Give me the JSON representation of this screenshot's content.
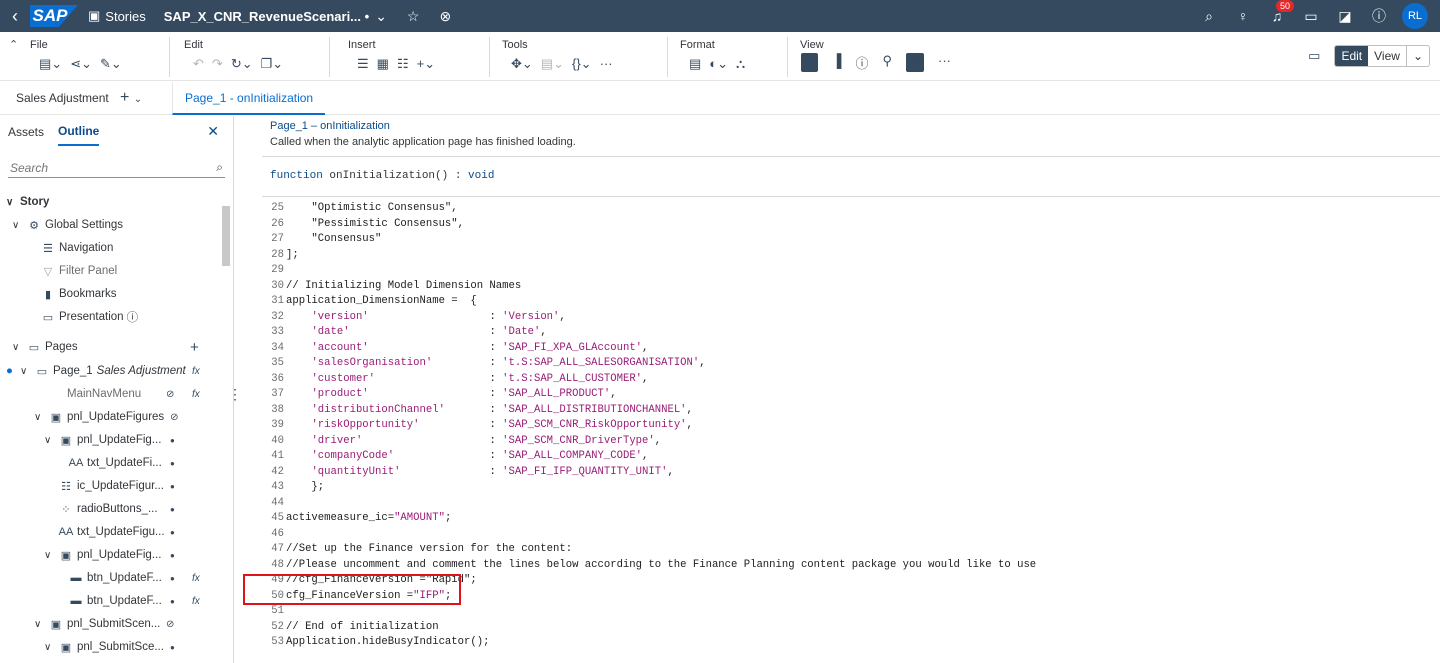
{
  "shell": {
    "logo": "SAP",
    "stories_label": "Stories",
    "story_title": "SAP_X_CNR_RevenueScenari... •",
    "notification_count": "50",
    "avatar_initials": "RL"
  },
  "toolbar": {
    "file_label": "File",
    "edit_label": "Edit",
    "insert_label": "Insert",
    "tools_label": "Tools",
    "format_label": "Format",
    "view_label": "View",
    "mode_edit": "Edit",
    "mode_view": "View"
  },
  "tabbar": {
    "sales_adjustment": "Sales Adjustment",
    "page_tab": "Page_1 - onInitialization"
  },
  "left_panel": {
    "tab_assets": "Assets",
    "tab_outline": "Outline",
    "search_placeholder": "Search",
    "tree": [
      {
        "label": "Story"
      },
      {
        "label": "Global Settings"
      },
      {
        "label": "Navigation"
      },
      {
        "label": "Filter Panel"
      },
      {
        "label": "Bookmarks"
      },
      {
        "label": "Presentation"
      },
      {
        "label": "Pages"
      },
      {
        "label": "Page_1",
        "suffix": "Sales Adjustment"
      },
      {
        "label": "MainNavMenu"
      },
      {
        "label": "pnl_UpdateFigures"
      },
      {
        "label": "pnl_UpdateFig..."
      },
      {
        "label": "txt_UpdateFi..."
      },
      {
        "label": "ic_UpdateFigur..."
      },
      {
        "label": "radioButtons_..."
      },
      {
        "label": "txt_UpdateFigu..."
      },
      {
        "label": "pnl_UpdateFig..."
      },
      {
        "label": "btn_UpdateF..."
      },
      {
        "label": "btn_UpdateF..."
      },
      {
        "label": "pnl_SubmitScen..."
      },
      {
        "label": "pnl_SubmitSce..."
      }
    ]
  },
  "editor": {
    "header_title": "Page_1 – onInitialization",
    "header_desc": "Called when the analytic application page has finished loading.",
    "sig_kw": "function",
    "sig_name": " onInitialization() : ",
    "sig_type": "void",
    "lines": [
      {
        "n": "25",
        "t": "    \"Optimistic Consensus\","
      },
      {
        "n": "26",
        "t": "    \"Pessimistic Consensus\","
      },
      {
        "n": "27",
        "t": "    \"Consensus\""
      },
      {
        "n": "28",
        "t": "];"
      },
      {
        "n": "29",
        "t": ""
      },
      {
        "n": "30",
        "t": "// Initializing Model Dimension Names"
      },
      {
        "n": "31",
        "t": "application_DimensionName =  {"
      },
      {
        "n": "32",
        "t": "    'version'                   : 'Version',"
      },
      {
        "n": "33",
        "t": "    'date'                      : 'Date',"
      },
      {
        "n": "34",
        "t": "    'account'                   : 'SAP_FI_XPA_GLAccount',"
      },
      {
        "n": "35",
        "t": "    'salesOrganisation'         : 't.S:SAP_ALL_SALESORGANISATION',"
      },
      {
        "n": "36",
        "t": "    'customer'                  : 't.S:SAP_ALL_CUSTOMER',"
      },
      {
        "n": "37",
        "t": "    'product'                   : 'SAP_ALL_PRODUCT',"
      },
      {
        "n": "38",
        "t": "    'distributionChannel'       : 'SAP_ALL_DISTRIBUTIONCHANNEL',"
      },
      {
        "n": "39",
        "t": "    'riskOpportunity'           : 'SAP_SCM_CNR_RiskOpportunity',"
      },
      {
        "n": "40",
        "t": "    'driver'                    : 'SAP_SCM_CNR_DriverType',"
      },
      {
        "n": "41",
        "t": "    'companyCode'               : 'SAP_ALL_COMPANY_CODE',"
      },
      {
        "n": "42",
        "t": "    'quantityUnit'              : 'SAP_FI_IFP_QUANTITY_UNIT',"
      },
      {
        "n": "43",
        "t": "    };"
      },
      {
        "n": "44",
        "t": ""
      },
      {
        "n": "45",
        "t": "activemeasure_ic=\"AMOUNT\";"
      },
      {
        "n": "46",
        "t": ""
      },
      {
        "n": "47",
        "t": "//Set up the Finance version for the content:"
      },
      {
        "n": "48",
        "t": "//Please uncomment and comment the lines below according to the Finance Planning content package you would like to use"
      },
      {
        "n": "49",
        "t": "//cfg_FinanceVersion =\"Rapid\";"
      },
      {
        "n": "50",
        "t": "cfg_FinanceVersion =\"IFP\";"
      },
      {
        "n": "51",
        "t": ""
      },
      {
        "n": "52",
        "t": "// End of initialization"
      },
      {
        "n": "53",
        "t": "Application.hideBusyIndicator();"
      }
    ]
  }
}
